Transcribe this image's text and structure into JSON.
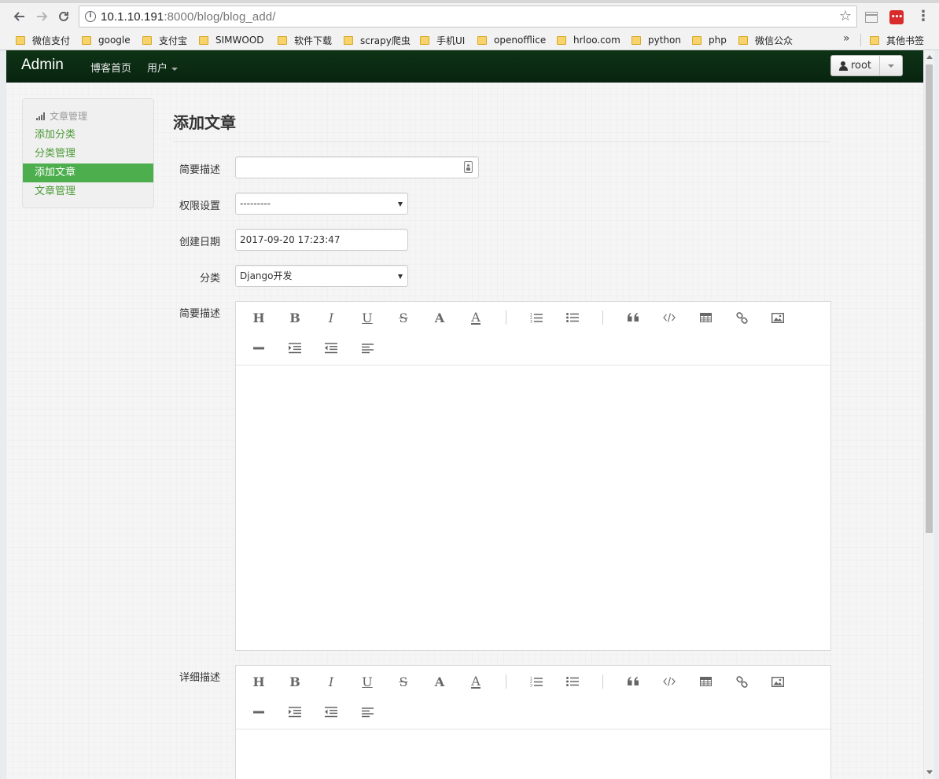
{
  "browser": {
    "url_host": "10.1.10.191",
    "url_path": ":8000/blog/blog_add/",
    "bookmarks": [
      "微信支付",
      "google",
      "支付宝",
      "SIMWOOD",
      "软件下载",
      "scrapy爬虫",
      "手机UI",
      "openofflice",
      "hrloo.com",
      "python",
      "php",
      "微信公众"
    ],
    "more_chevron": "»",
    "other_bookmarks": "其他书签",
    "extension_badge": "•••"
  },
  "navbar": {
    "brand": "Admin",
    "links": [
      "博客首页",
      "用户"
    ],
    "user": "root"
  },
  "sidebar": {
    "header": "文章管理",
    "items": [
      "添加分类",
      "分类管理",
      "添加文章",
      "文章管理"
    ],
    "active_index": 2
  },
  "form": {
    "title": "添加文章",
    "fields": {
      "summary_label": "简要描述",
      "summary_value": "",
      "permission_label": "权限设置",
      "permission_value": "---------",
      "created_label": "创建日期",
      "created_value": "2017-09-20 17:23:47",
      "category_label": "分类",
      "category_value": "Django开发",
      "brief_editor_label": "简要描述",
      "detail_editor_label": "详细描述"
    }
  },
  "editor_toolbar": {
    "tools": [
      "heading",
      "bold",
      "italic",
      "underline",
      "strikethrough",
      "font-color",
      "font-bg",
      "ordered-list",
      "unordered-list",
      "blockquote",
      "code",
      "table",
      "link",
      "image",
      "horizontal-rule",
      "indent",
      "outdent",
      "align"
    ],
    "glyphs": {
      "heading": "H",
      "bold": "B",
      "italic": "I",
      "underline": "U",
      "strikethrough": "S",
      "font-color": "A",
      "font-bg": "A"
    }
  },
  "colors": {
    "navbar": "#0b2d13",
    "accent_green": "#4cae4c",
    "link_green": "#4c9a36"
  }
}
